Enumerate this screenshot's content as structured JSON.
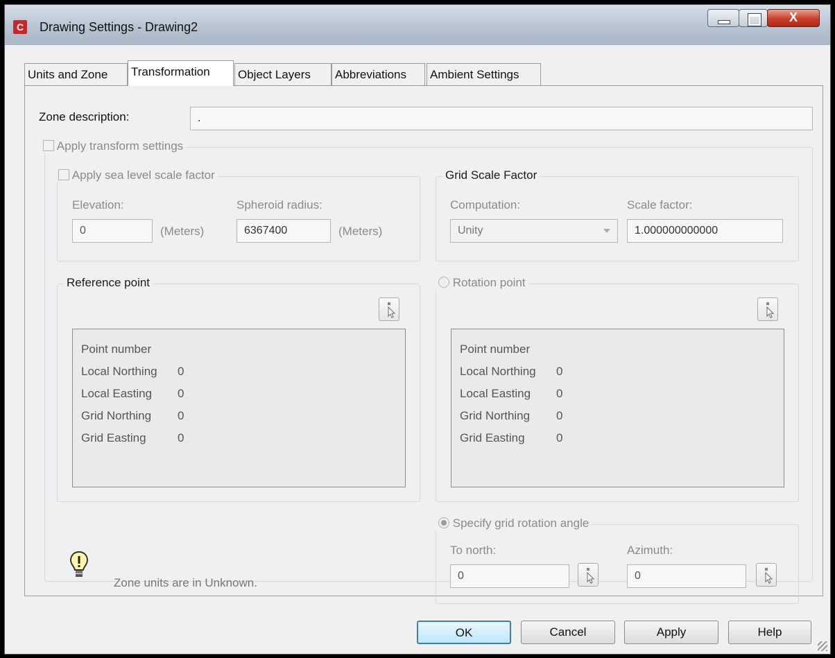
{
  "window": {
    "title": "Drawing Settings - Drawing2",
    "app_icon": "civil3d-icon",
    "close_label": "X"
  },
  "tabs": [
    {
      "label": "Units and Zone",
      "active": false
    },
    {
      "label": "Transformation",
      "active": true
    },
    {
      "label": "Object Layers",
      "active": false
    },
    {
      "label": "Abbreviations",
      "active": false
    },
    {
      "label": "Ambient Settings",
      "active": false
    }
  ],
  "zone": {
    "label": "Zone description:",
    "value": "."
  },
  "apply_transform": {
    "label": "Apply transform settings",
    "checked": false
  },
  "sea_level": {
    "label": "Apply sea level scale factor",
    "checked": false,
    "elevation_label": "Elevation:",
    "elevation_value": "0",
    "elevation_unit": "(Meters)",
    "spheroid_label": "Spheroid radius:",
    "spheroid_value": "6367400",
    "spheroid_unit": "(Meters)"
  },
  "grid_scale": {
    "title": "Grid Scale Factor",
    "computation_label": "Computation:",
    "computation_value": "Unity",
    "scale_label": "Scale factor:",
    "scale_value": "1.000000000000"
  },
  "reference_point": {
    "title": "Reference point",
    "rows": [
      {
        "label": "Point number",
        "value": ""
      },
      {
        "label": "Local Northing",
        "value": "0"
      },
      {
        "label": "Local Easting",
        "value": "0"
      },
      {
        "label": "Grid Northing",
        "value": "0"
      },
      {
        "label": "Grid Easting",
        "value": "0"
      }
    ]
  },
  "rotation_point": {
    "title": "Rotation point",
    "selected": false,
    "rows": [
      {
        "label": "Point number",
        "value": ""
      },
      {
        "label": "Local Northing",
        "value": "0"
      },
      {
        "label": "Local Easting",
        "value": "0"
      },
      {
        "label": "Grid Northing",
        "value": "0"
      },
      {
        "label": "Grid Easting",
        "value": "0"
      }
    ]
  },
  "grid_rotation": {
    "title": "Specify grid rotation angle",
    "selected": true,
    "to_north_label": "To north:",
    "to_north_value": "0",
    "azimuth_label": "Azimuth:",
    "azimuth_value": "0"
  },
  "info": {
    "icon": "lightbulb-icon",
    "text": "Zone units are in Unknown."
  },
  "buttons": {
    "ok": "OK",
    "cancel": "Cancel",
    "apply": "Apply",
    "help": "Help"
  },
  "colors": {
    "default_button_border": "#3c7fb1",
    "close_button": "#c8402a",
    "disabled_text": "#8a8a8a"
  }
}
